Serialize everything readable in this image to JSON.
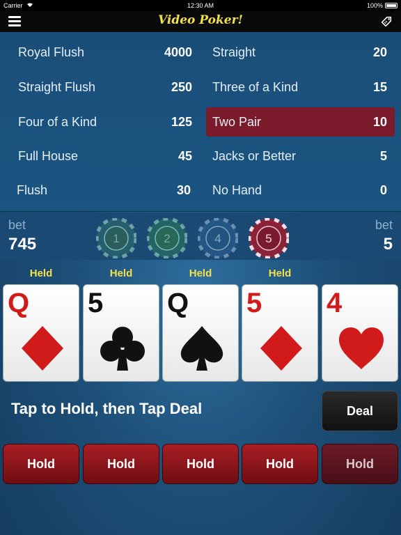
{
  "status_bar": {
    "carrier": "Carrier",
    "time": "12:30 AM",
    "battery": "100%"
  },
  "nav": {
    "title": "Video Poker!",
    "menu_icon": "hamburger-menu-icon",
    "right_icon": "tag-icon"
  },
  "paytable": {
    "left": [
      {
        "name": "Royal Flush",
        "value": "4000"
      },
      {
        "name": "Straight Flush",
        "value": "250"
      },
      {
        "name": "Four of a Kind",
        "value": "125"
      },
      {
        "name": "Full House",
        "value": "45"
      },
      {
        "name": "Flush",
        "value": "30"
      }
    ],
    "right": [
      {
        "name": "Straight",
        "value": "20"
      },
      {
        "name": "Three of a Kind",
        "value": "15"
      },
      {
        "name": "Two Pair",
        "value": "10"
      },
      {
        "name": "Jacks or Better",
        "value": "5"
      },
      {
        "name": "No Hand",
        "value": "0"
      }
    ],
    "highlighted": "Two Pair",
    "highlight_color": "#7a1a2b"
  },
  "bet": {
    "left_label": "bet",
    "left_value": "745",
    "right_label": "bet",
    "right_value": "5",
    "chips": [
      {
        "label": "1",
        "color": "#2f6f6a",
        "selected": false
      },
      {
        "label": "2",
        "color": "#2c7a5c",
        "selected": false
      },
      {
        "label": "4",
        "color": "#2a5f8f",
        "selected": false
      },
      {
        "label": "5",
        "color": "#8a2238",
        "selected": true
      }
    ]
  },
  "cards": [
    {
      "rank": "Q",
      "suit": "diamond",
      "color": "red",
      "held_label": "Held"
    },
    {
      "rank": "5",
      "suit": "club",
      "color": "black",
      "held_label": "Held"
    },
    {
      "rank": "Q",
      "suit": "spade",
      "color": "black",
      "held_label": "Held"
    },
    {
      "rank": "5",
      "suit": "diamond",
      "color": "red",
      "held_label": "Held"
    },
    {
      "rank": "4",
      "suit": "heart",
      "color": "red",
      "held_label": ""
    }
  ],
  "instructions": "Tap to Hold, then Tap Deal",
  "deal_label": "Deal",
  "hold_buttons": [
    "Hold",
    "Hold",
    "Hold",
    "Hold",
    "Hold"
  ],
  "colors": {
    "held_text": "#f4e14a",
    "title_text": "#f4e14a",
    "hold_button": "#a81e24"
  }
}
